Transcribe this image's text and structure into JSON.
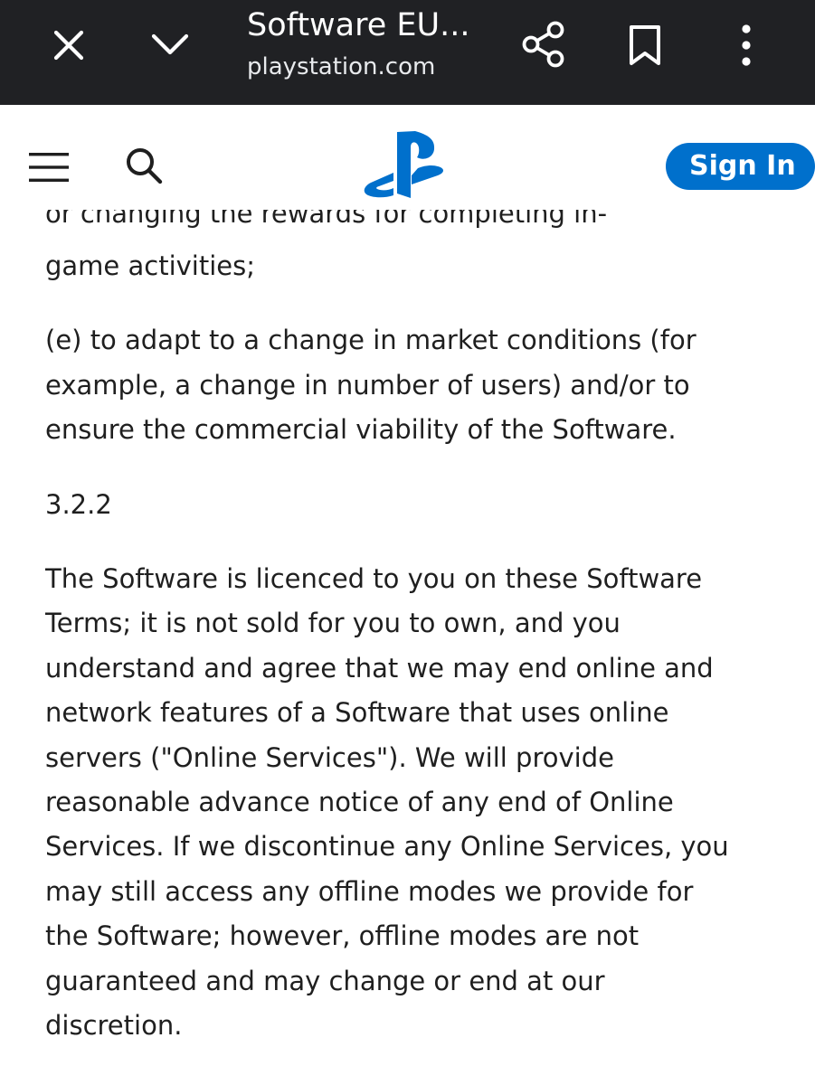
{
  "browser_bar": {
    "title": "Software EU...",
    "url": "playstation.com",
    "icons": {
      "close": "close-icon",
      "collapse": "chevron-down-icon",
      "share": "share-icon",
      "bookmark": "bookmark-icon",
      "menu": "more-vert-icon"
    }
  },
  "site_header": {
    "menu_icon": "hamburger-menu-icon",
    "search_icon": "search-icon",
    "logo": "playstation-logo",
    "sign_in_label": "Sign In"
  },
  "content": {
    "cut_line": "or changing the rewards for completing in-",
    "para_d_tail": "game activities;",
    "para_e": [
      "(e) to adapt to a change in market conditions (for",
      "example, a change in number of users) and/or to",
      "ensure the commercial viability of the Software."
    ],
    "section_number": "3.2.2",
    "para_322": [
      "The Software is licenced to you on these Software",
      "Terms; it is not sold for you to own, and you",
      "understand and agree that we may end online and",
      "network features of a Software that uses online",
      "servers (\"Online Services\"). We will provide",
      "reasonable advance notice of any end of Online",
      "Services. If we discontinue any Online Services, you",
      "may still access any offline modes we provide for",
      "the Software; however, offline modes are not",
      "guaranteed and may change or end at our",
      "discretion."
    ]
  },
  "colors": {
    "browser_bar_bg": "#202124",
    "accent_blue": "#0070cc",
    "body_text": "#1f1f1f",
    "page_bg": "#ffffff"
  }
}
